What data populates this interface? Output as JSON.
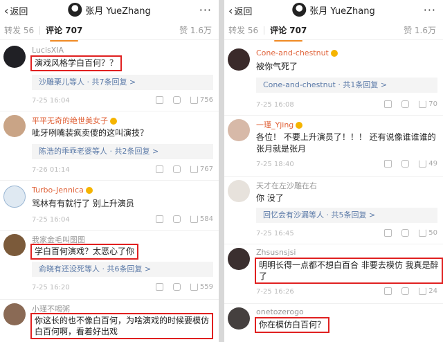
{
  "header": {
    "back_label": "返回",
    "user_name": "张月 YueZhang",
    "more_label": "···"
  },
  "tabs": {
    "repost_label": "转发 56",
    "comment_label": "评论 707",
    "like_label": "赞 1.6万"
  },
  "left_comments": [
    {
      "name": "LucisXIA",
      "text": "演戏风格学白百何？？",
      "reply": "沙雕栗儿等人 · 共7条回复 >",
      "time": "7-25 16:04",
      "likes": "756",
      "avatar_color": "#202025"
    },
    {
      "name": "平平无奇的绝世美女子",
      "text": "呲牙咧嘴装疯卖傻的这叫演技？",
      "reply": "陈浩的乖乖老婆等人 · 共2条回复 >",
      "time": "7-26 01:14",
      "likes": "767",
      "avatar_color": "#c9a486"
    },
    {
      "name": "Turbo-Jennica",
      "text": "骂林有有就行了  别上升演员",
      "time": "7-25 16:04",
      "likes": "584",
      "avatar_color": "#dfe9f2"
    },
    {
      "name": "我家金毛叫图图",
      "text": "学白百何演戏？太恶心了你",
      "reply": "俞晓有还没死等人 · 共6条回复 >",
      "time": "7-25 16:20",
      "likes": "559",
      "avatar_color": "#7b5a3a"
    },
    {
      "name": "小瑾不喝粥",
      "text_lines": [
        "你这长的也不像白百何，为啥演戏的时候要模仿",
        "白百何啊，看着好出戏"
      ],
      "avatar_color": "#8a6a55"
    }
  ],
  "right_comments": [
    {
      "name": "Cone-and-chestnut",
      "text": "被你气死了",
      "reply": "Cone-and-chestnut · 共1条回复 >",
      "time": "7-25 16:08",
      "likes": "70",
      "avatar_color": "#3a2a2a"
    },
    {
      "name": "一瑾_Yjing",
      "text_lines": [
        "各位！ 不要上升演员了！！！ 还有说像谁谁谁的",
        "张月就是张月"
      ],
      "time": "7-25 18:40",
      "likes": "49",
      "avatar_color": "#d7b9a8"
    },
    {
      "name": "天才在左沙雕在右",
      "text": "你  没了",
      "reply": "回忆会有沙漏等人 · 共5条回复 >",
      "time": "7-25 16:45",
      "likes": "50",
      "avatar_color": "#e7e2dc"
    },
    {
      "name": "Zhsusnsjsi",
      "text_lines": [
        "明明长得一点都不想白百合 非要去模仿 我真是醉",
        "了"
      ],
      "time": "7-25 16:26",
      "likes": "24",
      "avatar_color": "#3b2f2f"
    },
    {
      "name": "onetozerogo",
      "text": "你在模仿白百何？",
      "avatar_color": "#45403f"
    }
  ],
  "colors": {
    "highlight_box": "#e02020",
    "tab_underline": "#f08a24",
    "reply_link": "#5b7aa8"
  },
  "icons": [
    "chevron-left-icon",
    "more-icon",
    "share-icon",
    "comment-icon",
    "like-icon",
    "vip-badge-icon"
  ]
}
